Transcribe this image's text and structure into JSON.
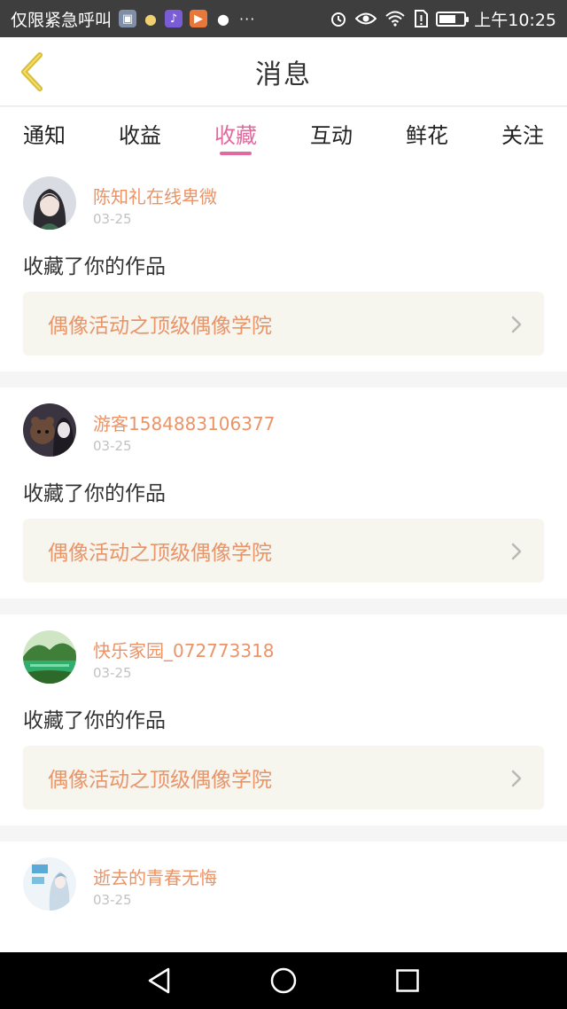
{
  "status_bar": {
    "carrier": "仅限紧急呼叫",
    "time": "上午10:25",
    "battery_level": 0.6,
    "icons": [
      "shield-icon",
      "bulb-icon",
      "music-icon",
      "video-icon",
      "wechat-icon",
      "more-icon",
      "alarm-icon",
      "eye-icon",
      "wifi-icon",
      "sim-alert-icon",
      "battery-icon"
    ]
  },
  "header": {
    "title": "消息",
    "back_icon": "chevron-left-icon"
  },
  "tabs": [
    {
      "label": "通知",
      "active": false
    },
    {
      "label": "收益",
      "active": false
    },
    {
      "label": "收藏",
      "active": true
    },
    {
      "label": "互动",
      "active": false
    },
    {
      "label": "鲜花",
      "active": false
    },
    {
      "label": "关注",
      "active": false
    }
  ],
  "messages": [
    {
      "username": "陈知礼在线卑微",
      "date": "03-25",
      "action": "收藏了你的作品",
      "work_title": "偶像活动之顶级偶像学院"
    },
    {
      "username": "游客1584883106377",
      "date": "03-25",
      "action": "收藏了你的作品",
      "work_title": "偶像活动之顶级偶像学院"
    },
    {
      "username": "快乐家园_072773318",
      "date": "03-25",
      "action": "收藏了你的作品",
      "work_title": "偶像活动之顶级偶像学院"
    },
    {
      "username": "逝去的青春无悔",
      "date": "03-25"
    }
  ],
  "colors": {
    "accent": "#e2699e",
    "username": "#ea9468",
    "work_box_bg": "#f6f5ee",
    "back_icon": "#d8bd3a"
  }
}
